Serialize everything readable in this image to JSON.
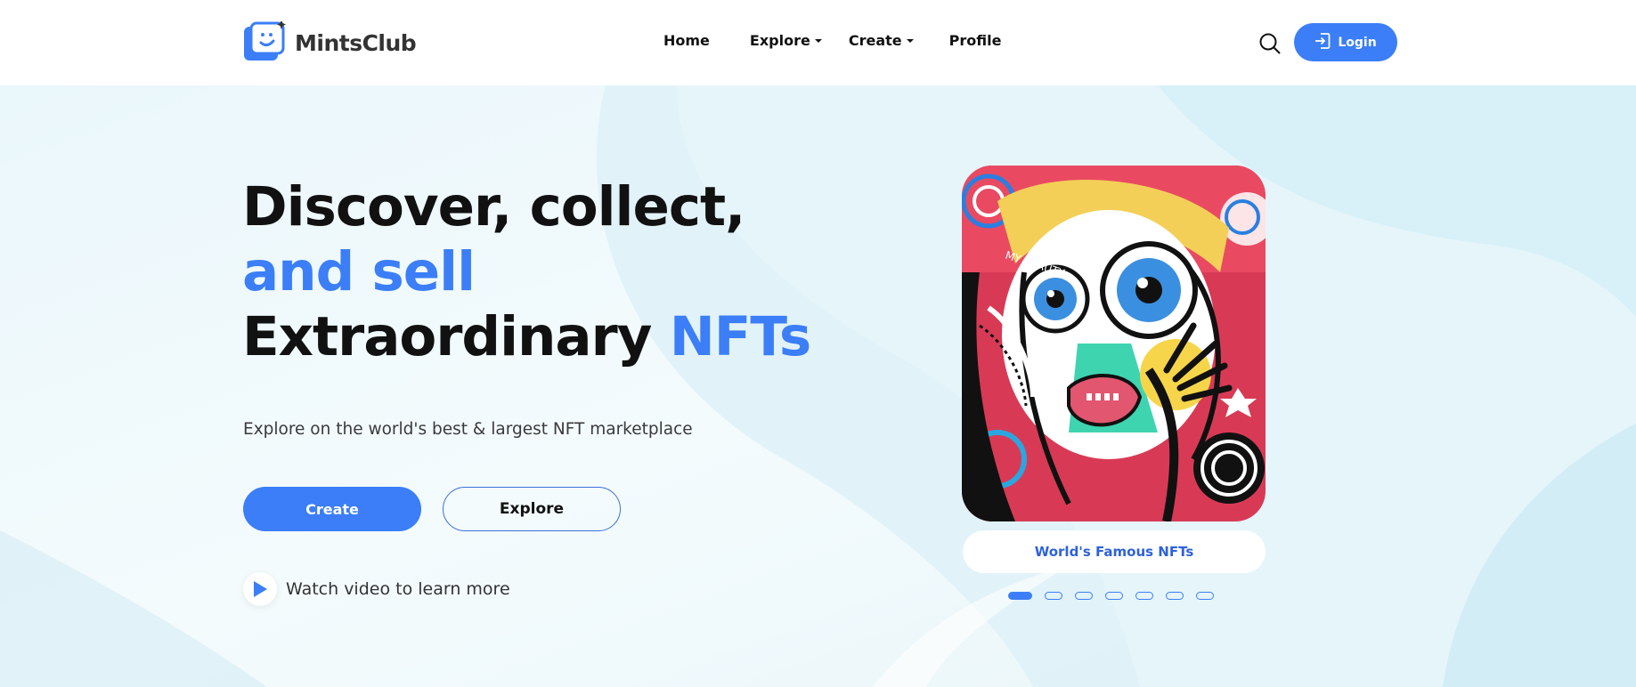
{
  "brand": {
    "name": "MintsClub",
    "accent": "#3b7ef7",
    "icon": "smiley-logo-icon"
  },
  "nav": {
    "items": [
      {
        "label": "Home",
        "dropdown": false
      },
      {
        "label": "Explore",
        "dropdown": true
      },
      {
        "label": "Create",
        "dropdown": true
      },
      {
        "label": "Profile",
        "dropdown": false
      }
    ]
  },
  "header": {
    "search_icon": "search-icon",
    "login_label": "Login",
    "login_icon": "login-arrow-icon"
  },
  "hero": {
    "headline_line1": "Discover, collect,",
    "headline_line2": "and sell",
    "headline_line3_dark": "Extraordinary",
    "headline_line3_blue": "NFTs",
    "subtitle": "Explore on the world's best & largest NFT marketplace",
    "create_label": "Create",
    "explore_label": "Explore",
    "watch_label": "Watch video to learn more",
    "play_icon": "play-icon"
  },
  "featured": {
    "caption": "World's Famous NFTs",
    "slides": 7,
    "active_slide": 1,
    "art_text": "MY BEAUTY QUEEN"
  }
}
